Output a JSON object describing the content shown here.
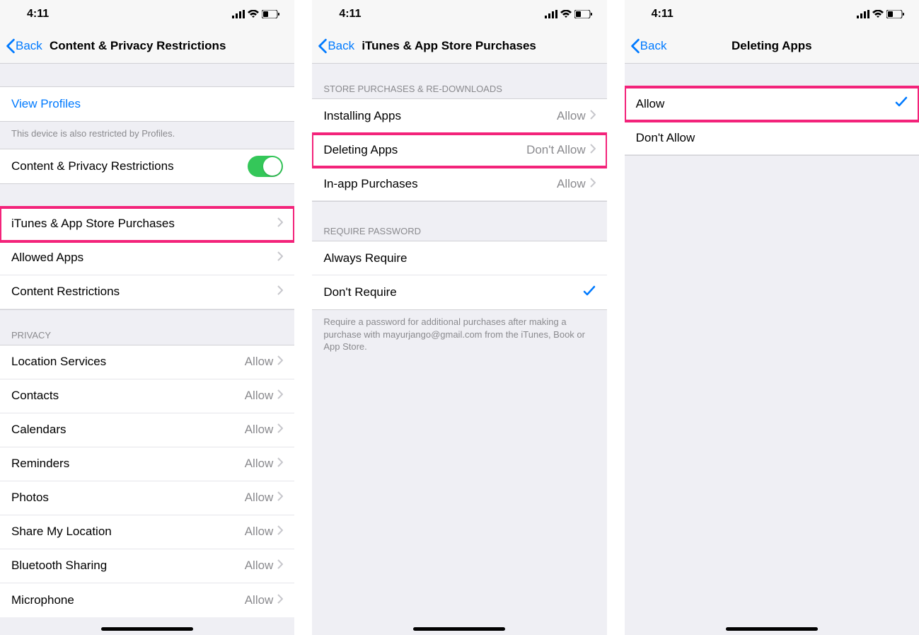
{
  "status": {
    "time": "4:11"
  },
  "screen1": {
    "back": "Back",
    "title": "Content & Privacy Restrictions",
    "view_profiles": "View Profiles",
    "profiles_note": "This device is also restricted by Profiles.",
    "toggle_label": "Content & Privacy Restrictions",
    "items_main": [
      {
        "label": "iTunes & App Store Purchases"
      },
      {
        "label": "Allowed Apps"
      },
      {
        "label": "Content Restrictions"
      }
    ],
    "privacy_header": "Privacy",
    "privacy_items": [
      {
        "label": "Location Services",
        "value": "Allow"
      },
      {
        "label": "Contacts",
        "value": "Allow"
      },
      {
        "label": "Calendars",
        "value": "Allow"
      },
      {
        "label": "Reminders",
        "value": "Allow"
      },
      {
        "label": "Photos",
        "value": "Allow"
      },
      {
        "label": "Share My Location",
        "value": "Allow"
      },
      {
        "label": "Bluetooth Sharing",
        "value": "Allow"
      },
      {
        "label": "Microphone",
        "value": "Allow"
      }
    ]
  },
  "screen2": {
    "back": "Back",
    "title": "iTunes & App Store Purchases",
    "store_header": "Store Purchases & Re-downloads",
    "store_items": [
      {
        "label": "Installing Apps",
        "value": "Allow"
      },
      {
        "label": "Deleting Apps",
        "value": "Don't Allow"
      },
      {
        "label": "In-app Purchases",
        "value": "Allow"
      }
    ],
    "require_header": "Require Password",
    "require_items": [
      {
        "label": "Always Require",
        "checked": false
      },
      {
        "label": "Don't Require",
        "checked": true
      }
    ],
    "footer": "Require a password for additional purchases after making a purchase with mayurjango@gmail.com from the iTunes, Book or App Store."
  },
  "screen3": {
    "back": "Back",
    "title": "Deleting Apps",
    "items": [
      {
        "label": "Allow",
        "checked": true
      },
      {
        "label": "Don't Allow",
        "checked": false
      }
    ]
  }
}
